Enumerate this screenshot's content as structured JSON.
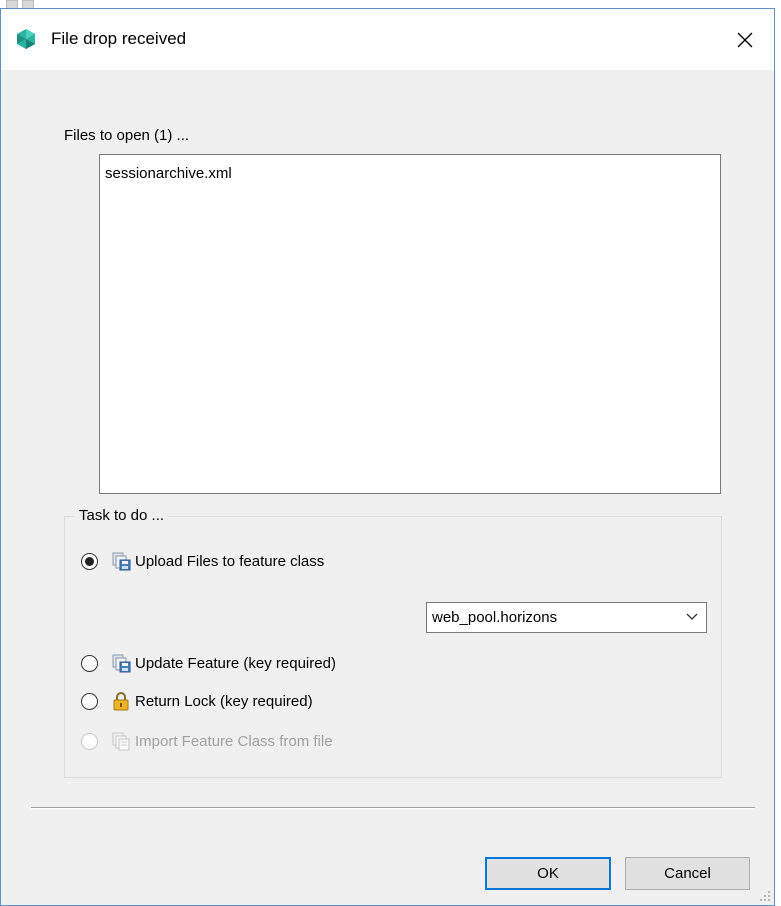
{
  "window": {
    "title": "File drop received",
    "close_symbol": "✕",
    "icon": "app-gem-icon"
  },
  "files": {
    "label": "Files to open (1) ...",
    "items": [
      "sessionarchive.xml"
    ]
  },
  "task": {
    "legend": "Task to do ...",
    "options": [
      {
        "label": "Upload Files to feature class",
        "checked": true,
        "enabled": true,
        "icon": "upload-files-icon"
      },
      {
        "label": "Update Feature (key required)",
        "checked": false,
        "enabled": true,
        "icon": "update-feature-icon"
      },
      {
        "label": "Return Lock (key required)",
        "checked": false,
        "enabled": true,
        "icon": "lock-icon"
      },
      {
        "label": "Import Feature Class from file",
        "checked": false,
        "enabled": false,
        "icon": "import-file-icon"
      }
    ],
    "feature_class": {
      "selected": "web_pool.horizons"
    }
  },
  "buttons": {
    "ok": "OK",
    "cancel": "Cancel"
  },
  "colors": {
    "accent": "#0078d7",
    "window_border": "#5d93c9",
    "dialog_bg": "#f0f0f0",
    "icon_teal": "#2bb3a3"
  }
}
